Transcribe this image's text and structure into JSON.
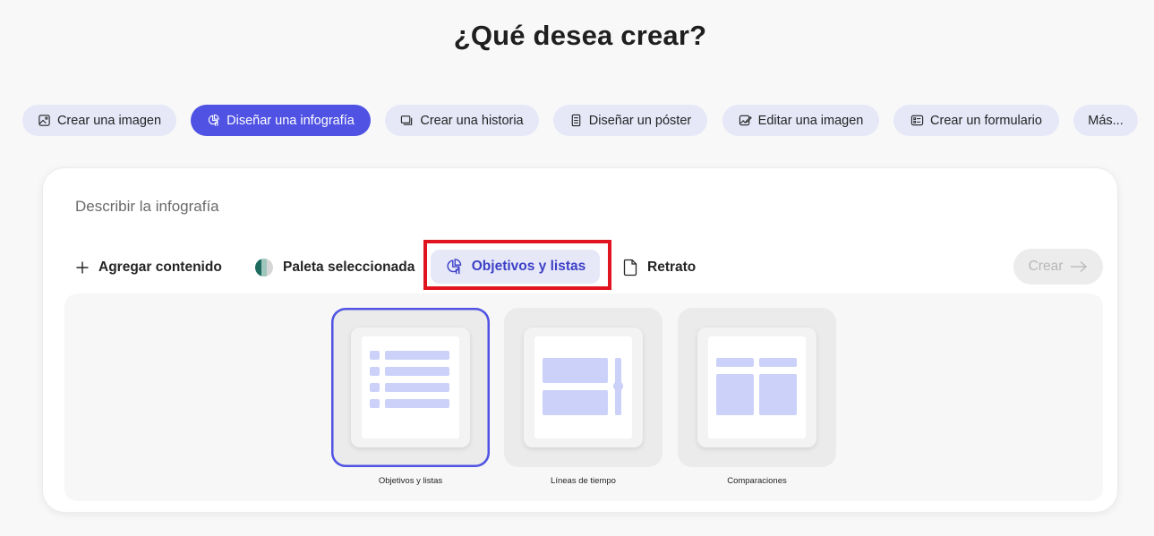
{
  "page": {
    "title": "¿Qué desea crear?"
  },
  "categories": [
    {
      "label": "Crear una imagen",
      "icon": "image-icon",
      "active": false
    },
    {
      "label": "Diseñar una infografía",
      "icon": "infographic-icon",
      "active": true
    },
    {
      "label": "Crear una historia",
      "icon": "story-icon",
      "active": false
    },
    {
      "label": "Diseñar un póster",
      "icon": "poster-icon",
      "active": false
    },
    {
      "label": "Editar una imagen",
      "icon": "edit-image-icon",
      "active": false
    },
    {
      "label": "Crear un formulario",
      "icon": "form-icon",
      "active": false
    },
    {
      "label": "Más...",
      "icon": "",
      "active": false
    }
  ],
  "prompt": {
    "placeholder": "Describir la infografía",
    "value": ""
  },
  "toolbar": {
    "add_content": "Agregar contenido",
    "palette": "Paleta seleccionada",
    "category": "Objetivos y listas",
    "orientation": "Retrato",
    "create": "Crear"
  },
  "templates": [
    {
      "label": "Objetivos y listas",
      "selected": true
    },
    {
      "label": "Líneas de tiempo",
      "selected": false
    },
    {
      "label": "Comparaciones",
      "selected": false
    }
  ],
  "colors": {
    "accent": "#4f52e3",
    "accent_soft": "#e6e8f8",
    "highlight": "#e0141e",
    "template_block": "#ccd1fa"
  }
}
